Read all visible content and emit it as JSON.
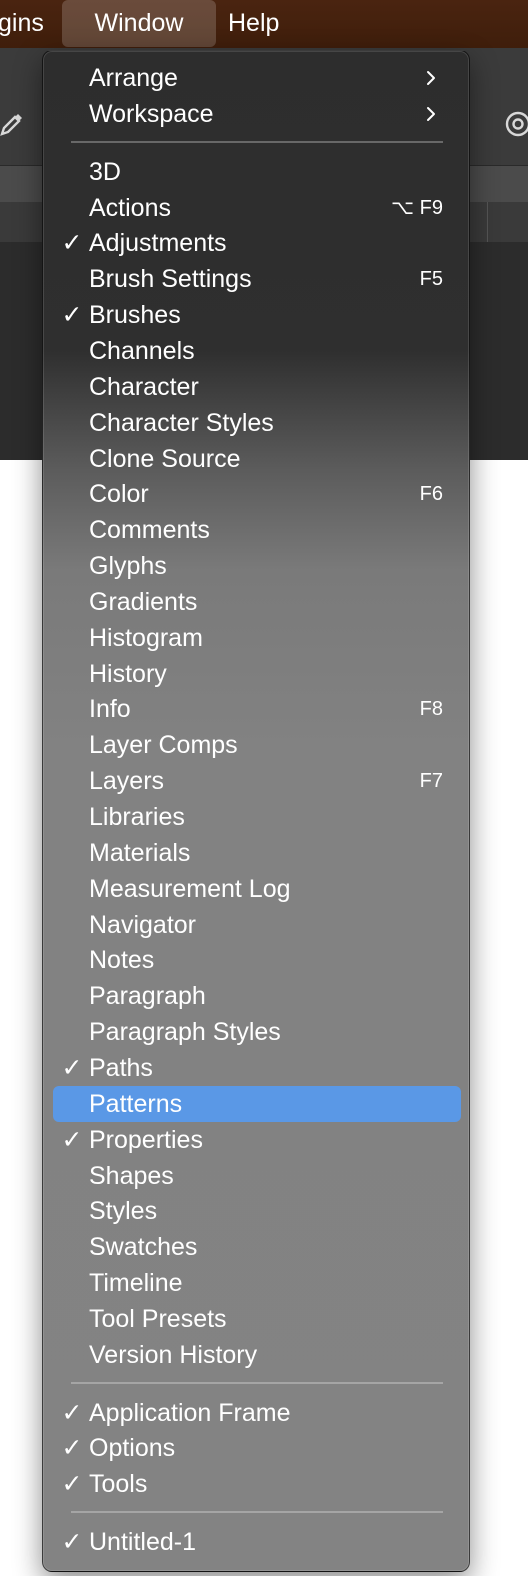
{
  "menubar": {
    "items": [
      "gins",
      "Window",
      "Help"
    ]
  },
  "menu": {
    "sections": [
      [
        {
          "label": "Arrange",
          "submenu": true
        },
        {
          "label": "Workspace",
          "submenu": true
        }
      ],
      [
        {
          "label": "3D"
        },
        {
          "label": "Actions",
          "shortcut": "⌥ F9"
        },
        {
          "label": "Adjustments",
          "checked": true
        },
        {
          "label": "Brush Settings",
          "shortcut": "F5"
        },
        {
          "label": "Brushes",
          "checked": true
        },
        {
          "label": "Channels"
        },
        {
          "label": "Character"
        },
        {
          "label": "Character Styles"
        },
        {
          "label": "Clone Source"
        },
        {
          "label": "Color",
          "shortcut": "F6"
        },
        {
          "label": "Comments"
        },
        {
          "label": "Glyphs"
        },
        {
          "label": "Gradients"
        },
        {
          "label": "Histogram"
        },
        {
          "label": "History"
        },
        {
          "label": "Info",
          "shortcut": "F8"
        },
        {
          "label": "Layer Comps"
        },
        {
          "label": "Layers",
          "shortcut": "F7"
        },
        {
          "label": "Libraries"
        },
        {
          "label": "Materials"
        },
        {
          "label": "Measurement Log"
        },
        {
          "label": "Navigator"
        },
        {
          "label": "Notes"
        },
        {
          "label": "Paragraph"
        },
        {
          "label": "Paragraph Styles"
        },
        {
          "label": "Paths",
          "checked": true
        },
        {
          "label": "Patterns",
          "highlighted": true
        },
        {
          "label": "Properties",
          "checked": true
        },
        {
          "label": "Shapes"
        },
        {
          "label": "Styles"
        },
        {
          "label": "Swatches"
        },
        {
          "label": "Timeline"
        },
        {
          "label": "Tool Presets"
        },
        {
          "label": "Version History"
        }
      ],
      [
        {
          "label": "Application Frame",
          "checked": true
        },
        {
          "label": "Options",
          "checked": true
        },
        {
          "label": "Tools",
          "checked": true
        }
      ],
      [
        {
          "label": "Untitled-1",
          "checked": true
        }
      ]
    ],
    "check_glyph": "✓"
  },
  "colors": {
    "menubar_bg": "#4a2410",
    "highlight": "#5a98e6",
    "menu_text": "#ffffff"
  },
  "icons": [
    "eyedropper-icon",
    "target-icon",
    "chevron-right-icon"
  ]
}
